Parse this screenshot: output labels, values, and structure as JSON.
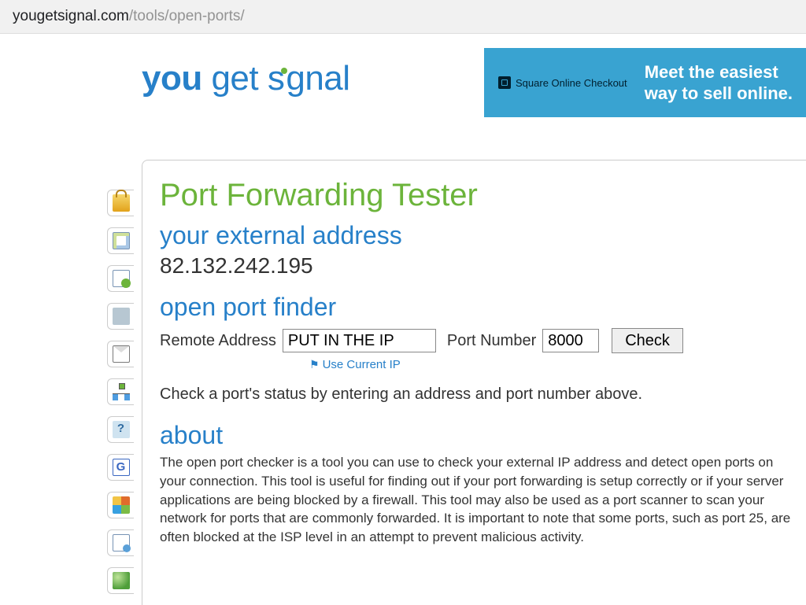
{
  "url": {
    "domain": "yougetsignal.com",
    "path": "/tools/open-ports/"
  },
  "logo": {
    "bold": "you",
    "mid": " get s",
    "after": "gnal"
  },
  "ad": {
    "brand": "Square Online Checkout",
    "headline1": "Meet the easiest",
    "headline2_pre": "way to ",
    "headline2_bold": "sell online."
  },
  "page": {
    "title": "Port Forwarding Tester",
    "ext_label": "your external address",
    "ext_ip": "82.132.242.195",
    "finder_label": "open port finder",
    "remote_label": "Remote Address",
    "remote_value": "PUT IN THE IP",
    "port_label": "Port Number",
    "port_value": "8000",
    "check_label": "Check",
    "use_current": "Use Current IP",
    "status": "Check a port's status by entering an address and port number above.",
    "about_label": "about",
    "about_text": "The open port checker is a tool you can use to check your external IP address and detect open ports on your connection. This tool is useful for finding out if your port forwarding is setup correctly or if your server applications are being blocked by a firewall. This tool may also be used as a port scanner to scan your network for ports that are commonly forwarded. It is important to note that some ports, such as port 25, are often blocked at the ISP level in an attempt to prevent malicious activity."
  },
  "side_tabs": [
    {
      "name": "lock-icon"
    },
    {
      "name": "map-icon"
    },
    {
      "name": "map-send-icon"
    },
    {
      "name": "phone-icon"
    },
    {
      "name": "mail-icon"
    },
    {
      "name": "network-icon"
    },
    {
      "name": "help-icon"
    },
    {
      "name": "google-icon"
    },
    {
      "name": "windows-icon"
    },
    {
      "name": "document-icon"
    },
    {
      "name": "globe-icon"
    }
  ]
}
